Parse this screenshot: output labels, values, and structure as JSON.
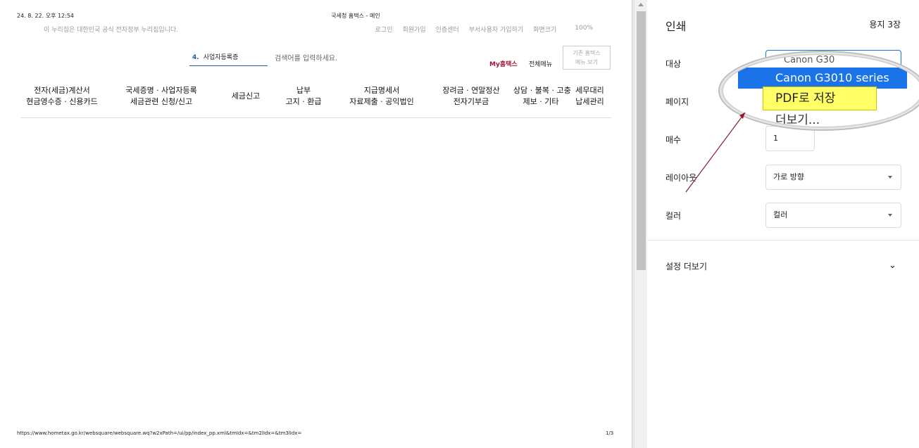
{
  "preview": {
    "header_date": "24. 8. 22. 오후 12:54",
    "header_title": "국세청 홈택스 - 메인",
    "notice": "이 누리집은 대한민국 공식 전자정부 누리집입니다.",
    "top_links": [
      "로그인",
      "회원가입",
      "인증센터",
      "부서사용자 가입하기",
      "화면크기"
    ],
    "zoom": "100%",
    "search_tag_number": "4.",
    "search_tag_text": "사업자등록증",
    "search_placeholder": "검색어를 입력하세요.",
    "my_hometax": "My홈택스",
    "all_menu": "전체메뉴",
    "old_menu_line1": "기존 홈택스",
    "old_menu_line2": "메뉴 보기",
    "nav": [
      {
        "line1": "전자(세금)계산서",
        "line2": "현금영수증 · 신용카드"
      },
      {
        "line1": "국세증명 · 사업자등록",
        "line2": "세금관련 신청/신고"
      },
      {
        "line1": "세금신고",
        "line2": ""
      },
      {
        "line1": "납부",
        "line2": "고지 · 환급"
      },
      {
        "line1": "지급명세서",
        "line2": "자료제출 · 공익법인"
      },
      {
        "line1": "장려금 · 연말정산",
        "line2": "전자기부금"
      },
      {
        "line1": "상담 · 불복 · 고충",
        "line2": "제보 · 기타"
      },
      {
        "line1": "세무대리",
        "line2": "납세관리"
      }
    ],
    "footer_url": "https://www.hometax.go.kr/websquare/websquare.wq?w2xPath=/ui/pp/index_pp.xml&tmIdx=&tm2lIdx=&tm3lIdx=",
    "footer_page": "1/3"
  },
  "print_panel": {
    "title": "인쇄",
    "sheets": "용지 3장",
    "destination_label": "대상",
    "pages_label": "페이지",
    "copies_label": "매수",
    "copies_value": "1",
    "layout_label": "레이아웃",
    "layout_value": "가로 방향",
    "color_label": "컬러",
    "color_value": "컬러",
    "more_settings": "설정 더보기"
  },
  "magnifier": {
    "top_partial": "Canon G30",
    "option_canon": "Canon G3010 series",
    "option_pdf": "PDF로 저장",
    "option_more": "더보기..."
  },
  "colors": {
    "accent_blue": "#1a73e8",
    "highlight_yellow": "#ffff66",
    "my_hometax_red": "#a0173a",
    "arrow_color": "#8b1a2b"
  }
}
